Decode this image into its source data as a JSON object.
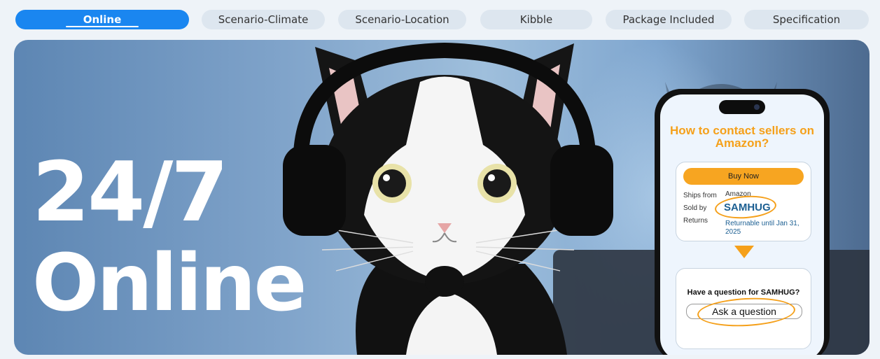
{
  "tabs": [
    {
      "label": "Online",
      "active": true
    },
    {
      "label": "Scenario-Climate",
      "active": false
    },
    {
      "label": "Scenario-Location",
      "active": false
    },
    {
      "label": "Kibble",
      "active": false
    },
    {
      "label": "Package Included",
      "active": false
    },
    {
      "label": "Specification",
      "active": false
    }
  ],
  "banner": {
    "headline_line1": "24/7",
    "headline_line2": "Online"
  },
  "phone": {
    "title": "How to contact sellers on Amazon?",
    "buy_button": "Buy Now",
    "ships_from_label": "Ships from",
    "ships_from_value": "Amazon",
    "sold_by_label": "Sold by",
    "sold_by_value": "SAMHUG",
    "returns_label": "Returns",
    "returns_value": "Returnable until Jan 31, 2025",
    "question_text": "Have a question for SAMHUG?",
    "ask_button": "Ask a question"
  },
  "colors": {
    "accent_blue": "#1a86f0",
    "tab_bg": "#dde6ef",
    "brand_orange": "#f5a01a",
    "seller_blue": "#1c5f92"
  }
}
